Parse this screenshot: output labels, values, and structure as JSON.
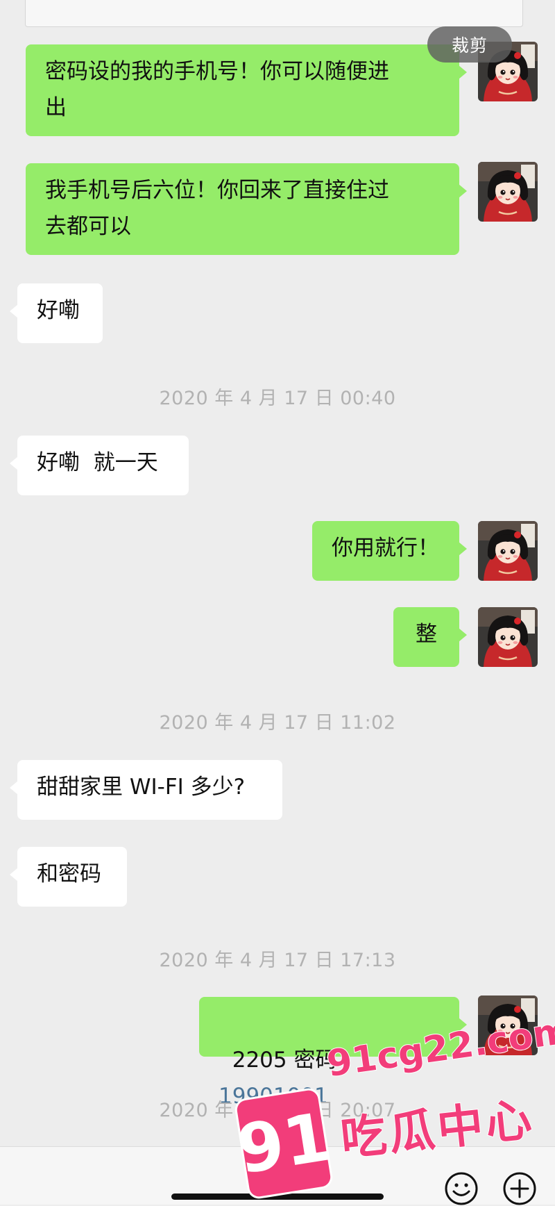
{
  "toolbar": {
    "crop_label": "裁剪"
  },
  "messages": [
    {
      "side": "me",
      "text": "密码设的我的手机号！你可以随便进\n出"
    },
    {
      "side": "me",
      "text": "我手机号后六位！你回来了直接住过\n去都可以"
    },
    {
      "side": "other",
      "text": "好嘞"
    },
    {
      "side": "other",
      "text": "好嘞  就一天"
    },
    {
      "side": "me",
      "text": "你用就行！"
    },
    {
      "side": "me",
      "text": "整"
    },
    {
      "side": "other",
      "text": "甜甜家里 WI-FI 多少?"
    },
    {
      "side": "other",
      "text": "和密码"
    },
    {
      "side": "me",
      "text_prefix": "2205 密码",
      "text_link": "19901001"
    }
  ],
  "timestamps": [
    "2020 年 4 月 17 日 00:40",
    "2020 年 4 月 17 日 11:02",
    "2020 年 4 月 17 日 17:13",
    "2020 年 4 月 17 日 20:07"
  ],
  "bottom_bar": {
    "icons": [
      "emoji-icon",
      "plus-icon"
    ]
  },
  "watermark": {
    "badge": "91",
    "url": "91cg22.com",
    "name": "吃瓜中心"
  },
  "colors": {
    "me_bubble": "#95ec69",
    "other_bubble": "#ffffff",
    "background": "#ededed",
    "watermark": "#f23d7a"
  }
}
